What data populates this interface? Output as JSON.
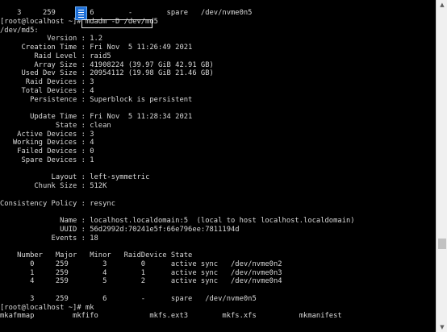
{
  "terminal": {
    "lines": [
      "    3     259        6        -        spare   /dev/nvme0n5",
      "[root@localhost ~]# mdadm -D /dev/md5",
      "/dev/md5:",
      "           Version : 1.2",
      "     Creation Time : Fri Nov  5 11:26:49 2021",
      "        Raid Level : raid5",
      "        Array Size : 41908224 (39.97 GiB 42.91 GB)",
      "     Used Dev Size : 20954112 (19.98 GiB 21.46 GB)",
      "      Raid Devices : 3",
      "     Total Devices : 4",
      "       Persistence : Superblock is persistent",
      "",
      "       Update Time : Fri Nov  5 11:28:34 2021",
      "             State : clean",
      "    Active Devices : 3",
      "   Working Devices : 4",
      "    Failed Devices : 0",
      "     Spare Devices : 1",
      "",
      "            Layout : left-symmetric",
      "        Chunk Size : 512K",
      "",
      "Consistency Policy : resync",
      "",
      "              Name : localhost.localdomain:5  (local to host localhost.localdomain)",
      "              UUID : 56d2992d:70241e5f:66e796ee:7811194d",
      "            Events : 18",
      "",
      "    Number   Major   Minor   RaidDevice State",
      "       0     259        3        0      active sync   /dev/nvme0n2",
      "       1     259        4        1      active sync   /dev/nvme0n3",
      "       4     259        5        2      active sync   /dev/nvme0n4",
      "",
      "       3     259        6        -      spare   /dev/nvme0n5",
      "[root@localhost ~]# mk",
      "mkafmmap         mkfifo            mkfs.ext3        mkfs.xfs          mkmanifest"
    ]
  },
  "scrollbar": {
    "up_arrow": "▲",
    "down_arrow": "▼"
  },
  "icons": {
    "file": "document-icon"
  }
}
